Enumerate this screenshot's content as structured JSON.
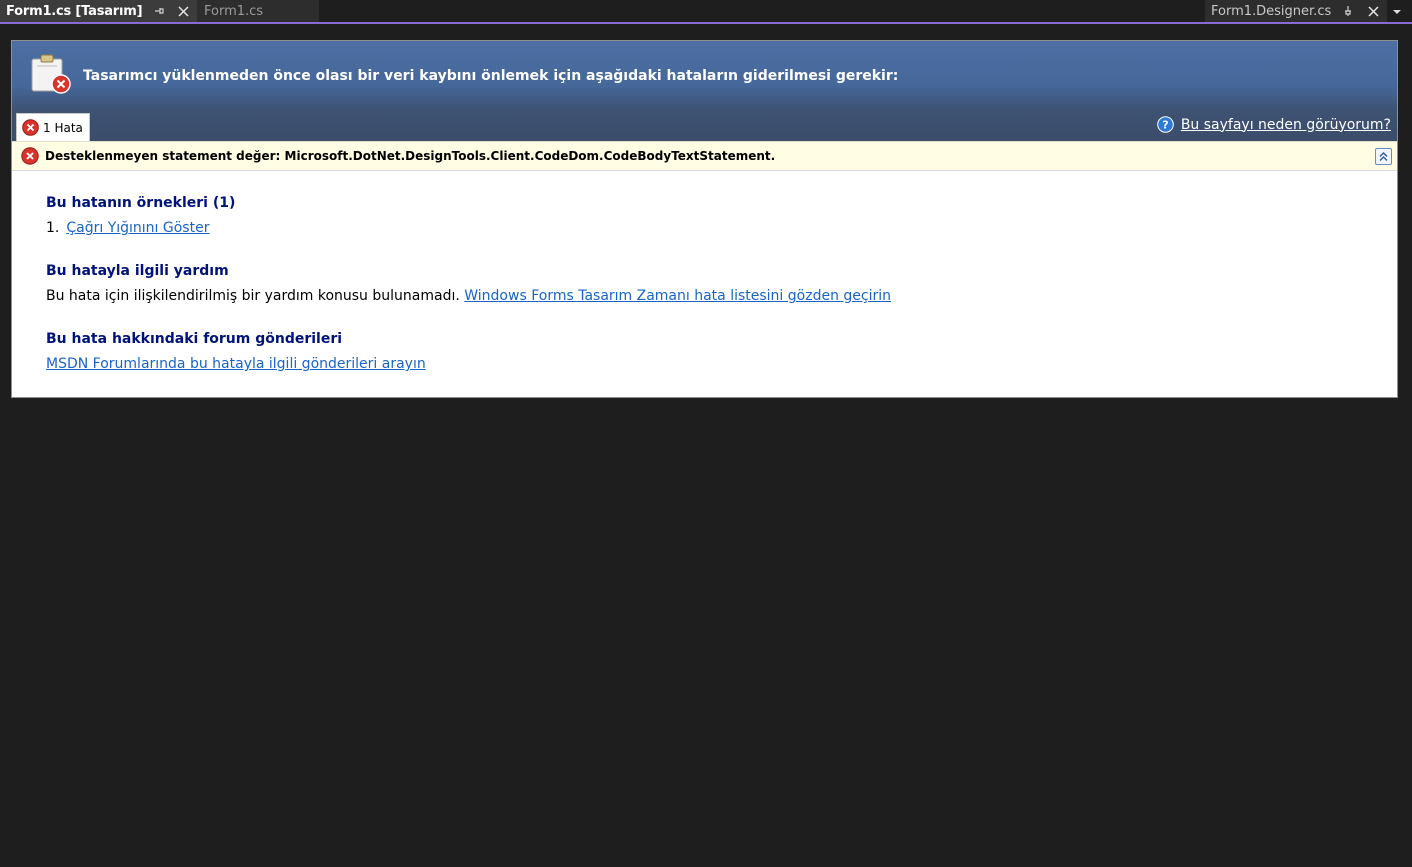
{
  "tabs": {
    "active": {
      "label": "Form1.cs [Tasarım]"
    },
    "inactive": {
      "label": "Form1.cs"
    },
    "right": {
      "label": "Form1.Designer.cs"
    }
  },
  "banner": {
    "title": "Tasarımcı yüklenmeden önce olası bir veri kaybını önlemek için aşağıdaki hataların giderilmesi gerekir:",
    "error_tab_label": "1 Hata",
    "help_link": "Bu sayfayı neden görüyorum?"
  },
  "error": {
    "message": "Desteklenmeyen statement değer: Microsoft.DotNet.DesignTools.Client.CodeDom.CodeBodyTextStatement."
  },
  "details": {
    "instances": {
      "title": "Bu hatanın örnekleri (1)",
      "number": "1.",
      "link": "Çağrı Yığınını Göster"
    },
    "help": {
      "title": "Bu hatayla ilgili yardım",
      "text": "Bu hata için ilişkilendirilmiş bir yardım konusu bulunamadı.",
      "link": "Windows Forms Tasarım Zamanı hata listesini gözden geçirin"
    },
    "forum": {
      "title": "Bu hata hakkındaki forum gönderileri",
      "link": "MSDN Forumlarında bu hatayla ilgili gönderileri arayın"
    }
  },
  "colors": {
    "accent": "#8a6ad6",
    "banner": "#4d6fa3",
    "section_title": "#00137a",
    "link": "#1864c8",
    "error_bar_bg": "#fffde4"
  }
}
